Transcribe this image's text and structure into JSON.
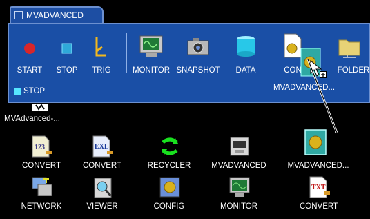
{
  "tab": {
    "title": "MVADVANCED"
  },
  "toolbar": {
    "start": "START",
    "stop": "STOP",
    "trig": "TRIG",
    "monitor": "MONITOR",
    "snapshot": "SNAPSHOT",
    "data": "DATA",
    "convert_partial": "CON",
    "folder": "FOLDER",
    "drag_label": "MVADVANCED..."
  },
  "status": {
    "text": "STOP",
    "indicator_color": "#56e6ff"
  },
  "desktop": {
    "partial_label": "MVAdvanced-...",
    "row1": [
      "CONVERT",
      "CONVERT",
      "RECYCLER",
      "MVADVANCED",
      "MVADVANCED..."
    ],
    "row2": [
      "NETWORK",
      "VIEWER",
      "CONFIG",
      "MONITOR",
      "CONVERT"
    ]
  },
  "colors": {
    "panel": "#1a4fa6",
    "background": "#000000",
    "accent": "#56e6ff"
  }
}
